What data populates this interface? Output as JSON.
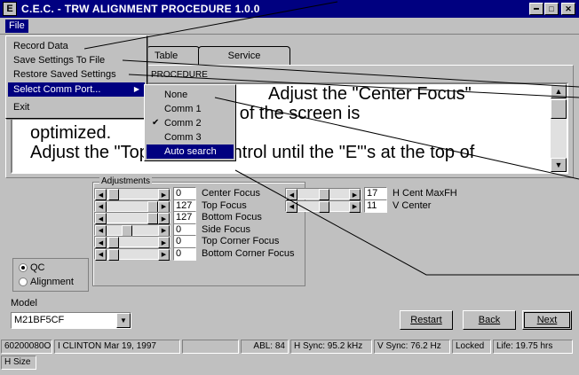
{
  "window": {
    "title": "C.E.C. - TRW ALIGNMENT PROCEDURE 1.0.0",
    "icon": "app-icon",
    "buttons": [
      "minimize",
      "maximize",
      "close"
    ]
  },
  "menubar": {
    "file_label": "File"
  },
  "file_menu": {
    "items": [
      {
        "label": "Record Data"
      },
      {
        "label": "Save Settings To File"
      },
      {
        "label": "Restore Saved Settings"
      },
      {
        "label": "Select Comm Port...",
        "arrow": "▶"
      },
      {
        "label": "Exit"
      }
    ]
  },
  "comm_submenu": {
    "items": [
      {
        "label": "None",
        "checked": false
      },
      {
        "label": "Comm 1",
        "checked": false
      },
      {
        "label": "Comm 2",
        "checked": true
      },
      {
        "label": "Comm 3",
        "checked": false
      },
      {
        "label": "Auto search",
        "checked": false
      }
    ]
  },
  "tabs": [
    {
      "label": "Table"
    },
    {
      "label": "Service"
    }
  ],
  "procedure": {
    "group_label": "PROCEDURE",
    "lines": [
      "Adjust the \"Center Focus\"",
      "control until the the center of the screen is",
      "optimized.",
      "Adjust the \"Top Focus\" control until the \"E\"'s at the top of"
    ]
  },
  "adjustments": {
    "group_label": "Adjustments",
    "left": [
      {
        "label": "Center Focus",
        "value": "0",
        "level": 0.05
      },
      {
        "label": "Top Focus",
        "value": "127",
        "level": 0.95
      },
      {
        "label": "Bottom Focus",
        "value": "127",
        "level": 0.95
      },
      {
        "label": "Side Focus",
        "value": "0",
        "level": 0.35
      },
      {
        "label": "Top Corner Focus",
        "value": "0",
        "level": 0.05
      },
      {
        "label": "Bottom Corner Focus",
        "value": "0",
        "level": 0.05
      }
    ],
    "right": [
      {
        "label": "H Cent MaxFH",
        "value": "17",
        "level": 0.5
      },
      {
        "label": "V Center",
        "value": "11",
        "level": 0.5
      }
    ]
  },
  "mode": {
    "options": [
      {
        "label": "QC",
        "selected": true
      },
      {
        "label": "Alignment",
        "selected": false
      }
    ]
  },
  "model": {
    "label": "Model",
    "value": "M21BF5CF"
  },
  "buttons": {
    "restart": "Restart",
    "back": "Back",
    "next": "Next"
  },
  "status": {
    "serial": "60200080O",
    "user_date": "I CLINTON  Mar 19, 1997",
    "blank": "",
    "abl": "ABL: 84",
    "hsync": "H Sync: 95.2 kHz",
    "vsync": "V Sync: 76.2 Hz",
    "lock": "Locked",
    "life": "Life: 19.75 hrs",
    "line2": "H Size"
  },
  "colors": {
    "titlebar": "#000080",
    "face": "#c0c0c0",
    "highlight": "#000080"
  }
}
